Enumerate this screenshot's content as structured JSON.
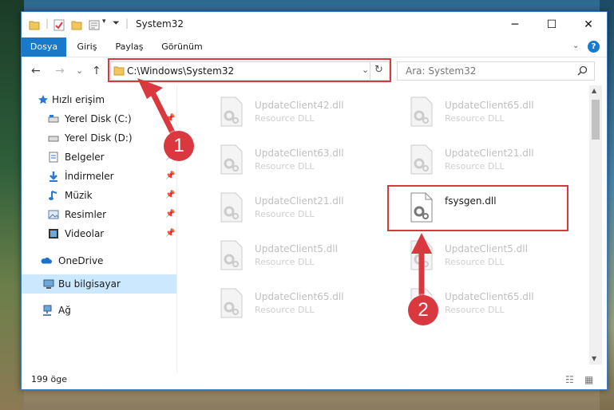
{
  "window": {
    "title": "System32"
  },
  "ribbon": {
    "tabs": [
      "Dosya",
      "Giriş",
      "Paylaş",
      "Görünüm"
    ],
    "help": "?"
  },
  "nav": {
    "back": "←",
    "forward": "→",
    "recent": "⌄",
    "up": "↑"
  },
  "address": {
    "path": "C:\\Windows\\System32",
    "refresh": "↻"
  },
  "search": {
    "placeholder": "Ara: System32"
  },
  "sidebar": {
    "items": [
      {
        "label": "Hızlı erişim"
      },
      {
        "label": "Yerel Disk (C:)"
      },
      {
        "label": "Yerel Disk (D:)"
      },
      {
        "label": "Belgeler"
      },
      {
        "label": "İndirmeler"
      },
      {
        "label": "Müzik"
      },
      {
        "label": "Resimler"
      },
      {
        "label": "Videolar"
      },
      {
        "label": "OneDrive"
      },
      {
        "label": "Bu bilgisayar"
      },
      {
        "label": "Ağ"
      }
    ]
  },
  "files": [
    {
      "name": "UpdateClient42.dll",
      "desc": "Resource DLL"
    },
    {
      "name": "UpdateClient65.dll",
      "desc": "Resource DLL"
    },
    {
      "name": "UpdateClient63.dll",
      "desc": "Resource DLL"
    },
    {
      "name": "UpdateClient21.dll",
      "desc": "Resource DLL"
    },
    {
      "name": "UpdateClient21.dll",
      "desc": "Resource DLL"
    },
    {
      "name": "fsysgen.dll",
      "desc": ""
    },
    {
      "name": "UpdateClient5.dll",
      "desc": "Resource DLL"
    },
    {
      "name": "UpdateClient5.dll",
      "desc": "Resource DLL"
    },
    {
      "name": "UpdateClient65.dll",
      "desc": "Resource DLL"
    },
    {
      "name": "UpdateClient65.dll",
      "desc": "Resource DLL"
    }
  ],
  "status": {
    "count": "199 öge"
  },
  "markers": {
    "one": "1",
    "two": "2"
  },
  "colors": {
    "accent": "#1979ca",
    "highlight": "#d9383f"
  }
}
